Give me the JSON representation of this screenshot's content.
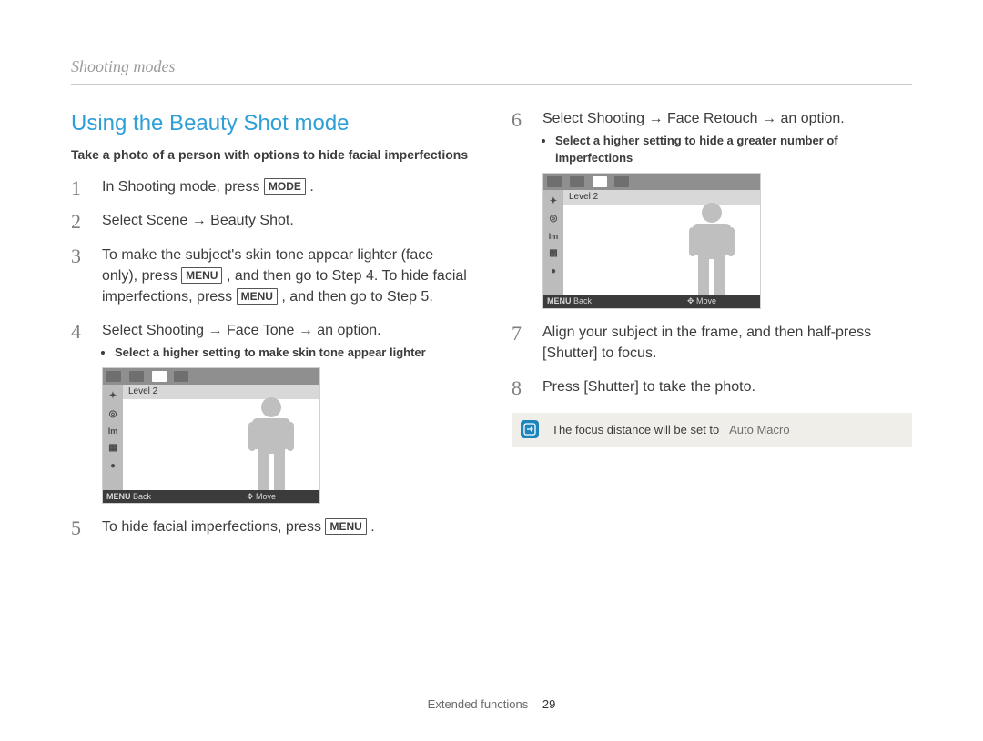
{
  "header": {
    "running": "Shooting modes"
  },
  "left": {
    "title": "Using the Beauty Shot mode",
    "lede": "Take a photo of a person with options to hide facial imperfections",
    "steps": {
      "s1": {
        "n": "1",
        "t_a": "In Shooting mode, press ",
        "key": "MODE",
        "t_b": " ."
      },
      "s2": {
        "n": "2",
        "t": "Select Scene → Beauty Shot."
      },
      "s3": {
        "n": "3",
        "t_a": "To make the subject's skin tone appear lighter (face only), press ",
        "key1": "MENU",
        "t_b": " , and then go to Step 4. To hide facial imperfections, press ",
        "key2": "MENU",
        "t_c": " , and then go to Step 5."
      },
      "s4": {
        "n": "4",
        "t": "Select Shooting → Face Tone → an option.",
        "bullet": "Select a higher setting to make skin tone appear lighter"
      },
      "s5": {
        "n": "5",
        "t_a": "To hide facial imperfections, press ",
        "key": "MENU",
        "t_b": " ."
      }
    },
    "lcd": {
      "level": "Level 2",
      "back_key": "MENU",
      "back": "Back",
      "move": "Move"
    }
  },
  "right": {
    "steps": {
      "s6": {
        "n": "6",
        "t": "Select Shooting → Face Retouch → an option.",
        "bullet": "Select a higher setting to hide a greater number of imperfections"
      },
      "s7": {
        "n": "7",
        "t": "Align your subject in the frame, and then half-press [Shutter] to focus."
      },
      "s8": {
        "n": "8",
        "t": "Press [Shutter] to take the photo."
      }
    },
    "lcd": {
      "level": "Level 2",
      "back_key": "MENU",
      "back": "Back",
      "move": "Move"
    },
    "note": {
      "text": "The focus distance will be set to",
      "value": "Auto Macro"
    }
  },
  "footer": {
    "section": "Extended functions",
    "page": "29"
  },
  "icons": {
    "sidebar": [
      "sparkle-icon",
      "target-icon",
      "im-icon",
      "grid-icon",
      "mic-off-icon"
    ]
  }
}
